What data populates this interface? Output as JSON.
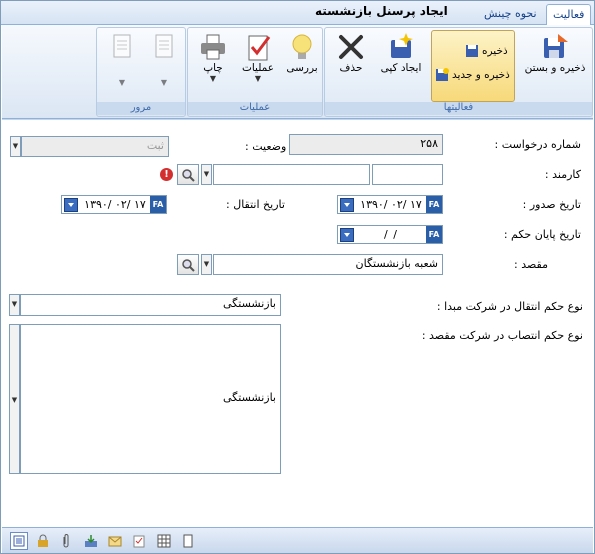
{
  "window": {
    "title": "ایجاد پرسنل بازنشسته"
  },
  "tabs": [
    {
      "label": "فعالیت"
    },
    {
      "label": "نحوه چینش"
    }
  ],
  "ribbon": {
    "groups": [
      {
        "label": "فعالیتها"
      },
      {
        "label": "عملیات"
      },
      {
        "label": "مرور"
      }
    ],
    "buttons": {
      "save_close": "ذخیره و بستن",
      "save": "ذخیره",
      "save_new": "ذخیره و جدید",
      "create_copy": "ایجاد کپی",
      "delete": "حذف",
      "review": "بررسی",
      "operations": "عملیات",
      "print": "چاپ"
    }
  },
  "form": {
    "request_number_label": "شماره درخواست :",
    "request_number_value": "۲۵۸",
    "status_label": "وضعیت :",
    "status_value": "ثبت",
    "employee_label": "کارمند :",
    "issue_date_label": "تاریخ صدور :",
    "issue_date_value": "۱۳۹۰/ ۰۲/ ۱۷",
    "transfer_date_label": "تاریخ انتقال :",
    "transfer_date_value": "۱۳۹۰/ ۰۲/ ۱۷",
    "end_date_label": "تاریخ پایان حکم :",
    "end_date_value": "/   /",
    "destination_label": "مقصد :",
    "destination_value": "شعبه بازنشستگان",
    "source_order_label": "نوع حکم انتقال در شرکت مبدا :",
    "source_order_value": "بازنشستگی",
    "dest_order_label": "نوع حکم انتصاب در شرکت مقصد :",
    "dest_order_value": "بازنشستگی",
    "date_badge": "FA"
  },
  "colors": {
    "accent": "#15428b",
    "ribbon_bg": "#dbe6f4",
    "badge": "#2a5ea7",
    "error": "#d32f2f"
  }
}
